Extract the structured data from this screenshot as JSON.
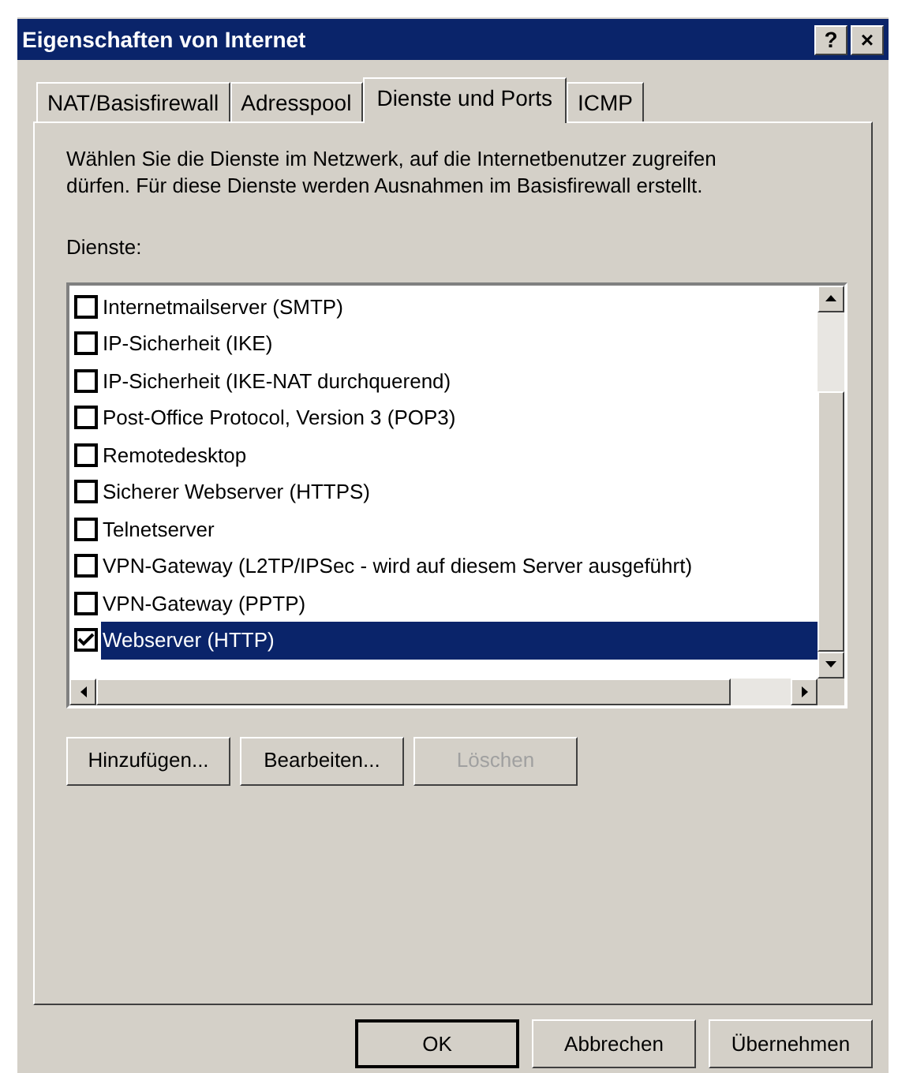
{
  "window": {
    "title": "Eigenschaften von Internet",
    "title_buttons": [
      "?",
      "×"
    ]
  },
  "tabs": [
    {
      "label": "NAT/Basisfirewall",
      "selected": false
    },
    {
      "label": "Adresspool",
      "selected": false
    },
    {
      "label": "Dienste und Ports",
      "selected": true
    },
    {
      "label": "ICMP",
      "selected": false
    }
  ],
  "description": "Wählen Sie die Dienste im Netzwerk, auf die Internetbenutzer zugreifen dürfen. Für diese Dienste werden Ausnahmen im Basisfirewall erstellt.",
  "services_label": "Dienste:",
  "services": [
    {
      "label": "Internetmailserver (SMTP)",
      "checked": false,
      "selected": false
    },
    {
      "label": "IP-Sicherheit (IKE)",
      "checked": false,
      "selected": false
    },
    {
      "label": "IP-Sicherheit (IKE-NAT durchquerend)",
      "checked": false,
      "selected": false
    },
    {
      "label": "Post-Office Protocol, Version 3 (POP3)",
      "checked": false,
      "selected": false
    },
    {
      "label": "Remotedesktop",
      "checked": false,
      "selected": false
    },
    {
      "label": "Sicherer Webserver (HTTPS)",
      "checked": false,
      "selected": false
    },
    {
      "label": "Telnetserver",
      "checked": false,
      "selected": false
    },
    {
      "label": "VPN-Gateway (L2TP/IPSec - wird auf diesem Server ausgeführt)",
      "checked": false,
      "selected": false
    },
    {
      "label": "VPN-Gateway (PPTP)",
      "checked": false,
      "selected": false
    },
    {
      "label": "Webserver (HTTP)",
      "checked": true,
      "selected": true
    }
  ],
  "list_buttons": [
    {
      "label": "Hinzufügen...",
      "disabled": false
    },
    {
      "label": "Bearbeiten...",
      "disabled": false
    },
    {
      "label": "Löschen",
      "disabled": true
    }
  ],
  "dialog_buttons": [
    {
      "label": "OK",
      "default": true
    },
    {
      "label": "Abbrechen",
      "default": false
    },
    {
      "label": "Übernehmen",
      "default": false
    }
  ]
}
